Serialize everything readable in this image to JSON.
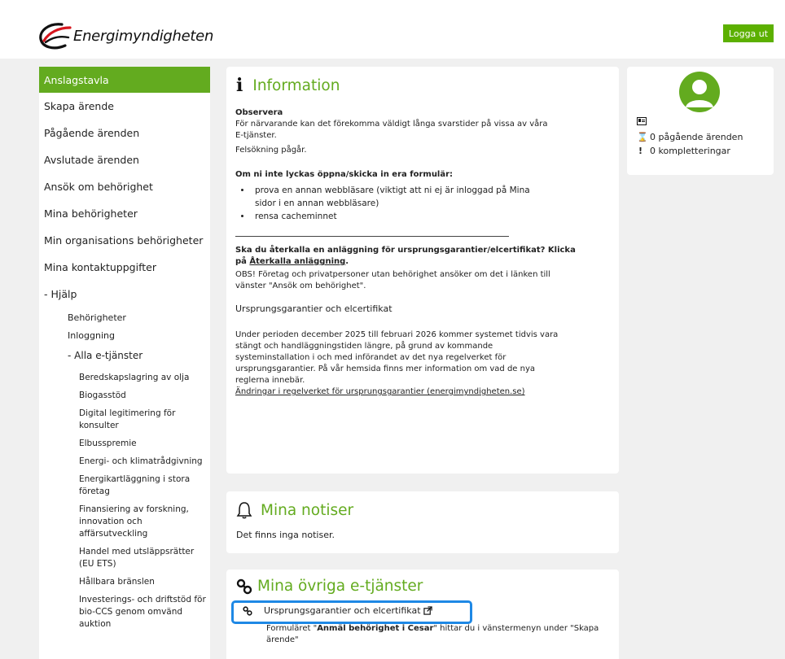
{
  "header": {
    "brand": "Energimyndigheten",
    "logout_label": "Logga ut"
  },
  "sidebar": {
    "items": [
      {
        "label": "Anslagstavla",
        "active": true
      },
      {
        "label": "Skapa ärende"
      },
      {
        "label": "Pågående ärenden"
      },
      {
        "label": "Avslutade ärenden"
      },
      {
        "label": "Ansök om behörighet"
      },
      {
        "label": "Mina behörigheter"
      },
      {
        "label": "Min organisations behörigheter"
      },
      {
        "label": "Mina kontaktuppgifter"
      },
      {
        "label": "- Hjälp"
      }
    ],
    "help_items": [
      "Behörigheter",
      "Inloggning"
    ],
    "all_services_label": "- Alla e-tjänster",
    "services": [
      "Beredskapslagring av olja",
      "Biogasstöd",
      "Digital legitimering för konsulter",
      "Elbusspremie",
      "Energi- och klimatrådgivning",
      "Energikartläggning i stora företag",
      "Finansiering av forskning, innovation och affärsutveckling",
      "Handel med utsläppsrätter (EU ETS)",
      "Hållbara bränslen",
      "Investerings- och driftstöd för bio-CCS genom omvänd auktion"
    ]
  },
  "info": {
    "title": "Information",
    "observe_heading": "Observera",
    "observe_text1": "För närvarande kan det förekomma väldigt långa svarstider på vissa av våra E-tjänster.",
    "observe_text2": "Felsökning pågår.",
    "form_heading": "Om ni inte lyckas öppna/skicka in era formulär:",
    "bullets": [
      "prova en annan webbläsare (viktigt att ni ej är inloggad på Mina sidor i en annan webbläsare)",
      "rensa cacheminnet"
    ],
    "withdraw_text": "Ska du återkalla en anläggning för ursprungsgarantier/elcertifikat? Klicka på",
    "withdraw_link": "Återkalla anläggning",
    "withdraw_end": ".",
    "obs_text": "OBS! Företag och privatpersoner utan behörighet ansöker om det i länken till vänster \"Ansök om behörighet\".",
    "section_heading": "Ursprungsgarantier och elcertifikat",
    "section_text": "Under perioden december 2025 till februari 2026 kommer systemet tidvis vara stängt och handläggningstiden längre, på grund av kommande systeminstallation i och med införandet av det nya regelverket för ursprungsgarantier. På vår hemsida finns mer information om vad de nya reglerna innebär.",
    "section_link": "Ändringar i regelverket för ursprungsgarantier (energimyndigheten.se)"
  },
  "notiser": {
    "title": "Mina notiser",
    "empty_text": "Det finns inga notiser."
  },
  "ovriga": {
    "title": "Mina övriga e-tjänster",
    "link_label": "Ursprungsgarantier och elcertifikat",
    "note_pre": "Formuläret \"",
    "note_bold": "Anmäl behörighet i Cesar",
    "note_post": "\" hittar du i vänstermenyn under \"Skapa ärende\""
  },
  "profile": {
    "ongoing": "0 pågående ärenden",
    "completions": "0 kompletteringar"
  },
  "colors": {
    "brand_green": "#63ab1f",
    "button_green": "#5cb000",
    "highlight_blue": "#1e88e5"
  }
}
